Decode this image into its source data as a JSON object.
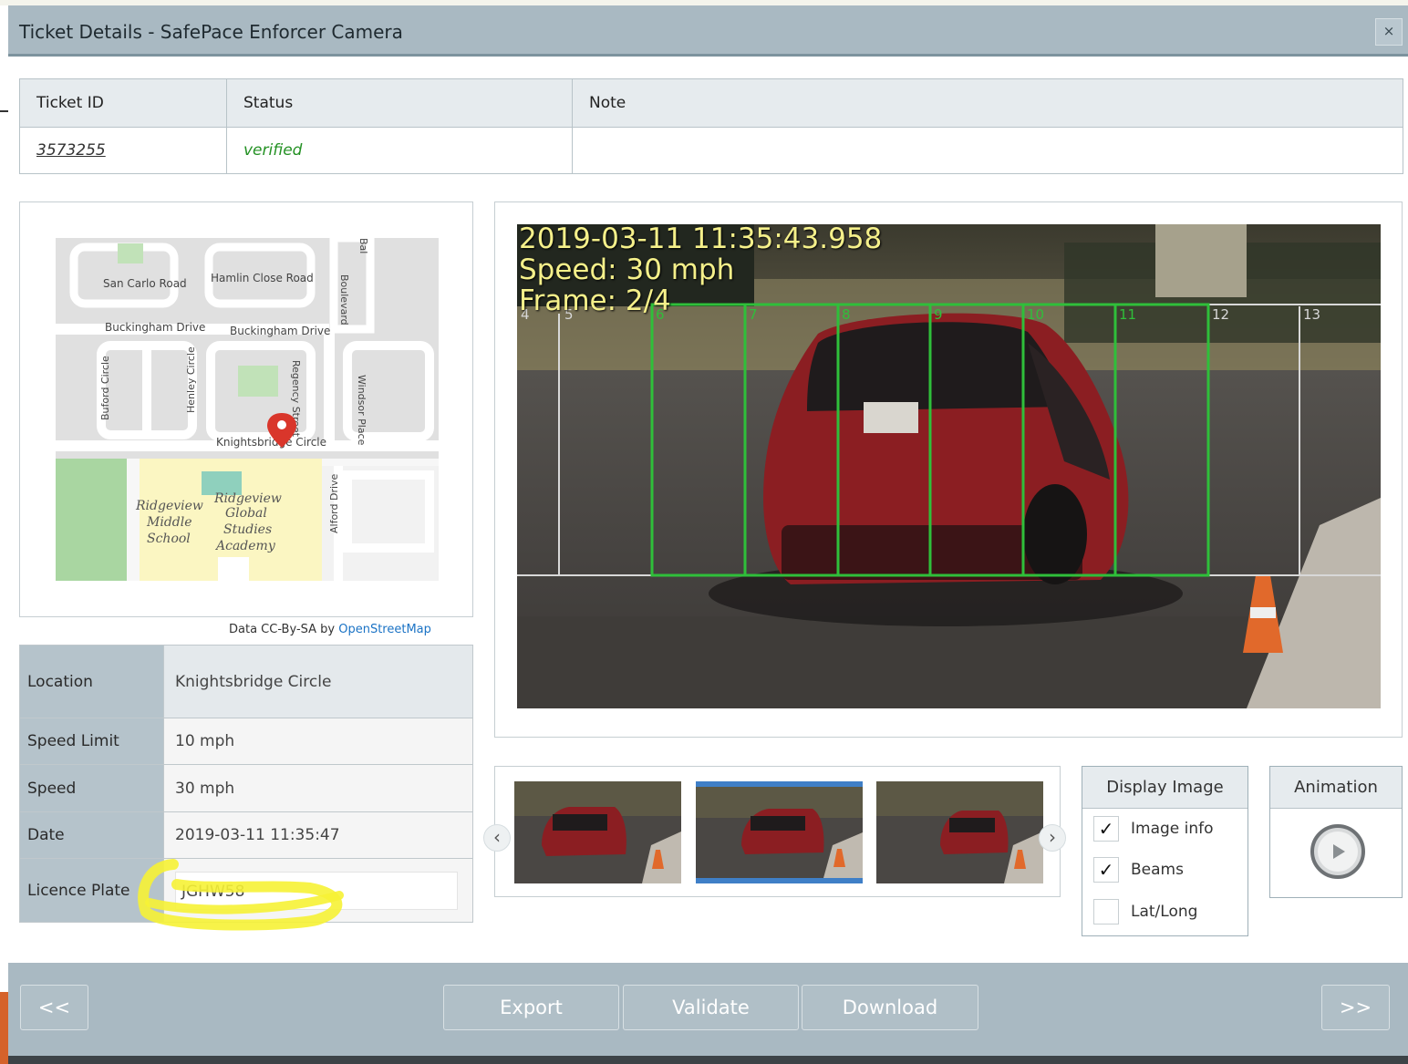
{
  "window": {
    "title": "Ticket Details - SafePace Enforcer Camera",
    "close_label": "×"
  },
  "ticket_table": {
    "headers": [
      "Ticket ID",
      "Status",
      "Note"
    ],
    "row": {
      "ticket_id": "3573255",
      "status": "verified",
      "note": ""
    }
  },
  "map": {
    "labels": {
      "san_carlo": "San Carlo Road",
      "hamlin": "Hamlin Close Road",
      "buckingham_1": "Buckingham Drive",
      "buckingham_2": "Buckingham Drive",
      "buford": "Buford Circle",
      "henley": "Henley Circle",
      "regency": "Regency Street",
      "windsor": "Windsor Place",
      "knightsbridge": "Knightsbridge Circle",
      "school_1_line1": "Ridgeview",
      "school_1_line2": "Middle",
      "school_1_line3": "School",
      "school_2_line1": "Ridgeview",
      "school_2_line2": "Global",
      "school_2_line3": "Studies",
      "school_2_line4": "Academy",
      "alford": "Alford Drive",
      "boulevard": "Boulevard",
      "bal": "Bal"
    },
    "credit_prefix": "Data CC-By-SA by ",
    "credit_link": "OpenStreetMap"
  },
  "info": {
    "location_label": "Location",
    "location_value": "Knightsbridge Circle",
    "speed_limit_label": "Speed Limit",
    "speed_limit_value": "10 mph",
    "speed_label": "Speed",
    "speed_value": "30 mph",
    "date_label": "Date",
    "date_value": "2019-03-11 11:35:47",
    "plate_label": "Licence Plate",
    "plate_value": "JGHW58"
  },
  "photo": {
    "timestamp": "2019-03-11 11:35:43.958",
    "speed": "Speed: 30 mph",
    "frame": "Frame: 2/4",
    "beam_labels": [
      "4",
      "5",
      "6",
      "7",
      "8",
      "9",
      "10",
      "11",
      "12",
      "13"
    ]
  },
  "thumbnails": {
    "prev": "‹",
    "next": "›",
    "selected_index": 1
  },
  "display_image": {
    "title": "Display Image",
    "options": [
      {
        "label": "Image info",
        "checked": "✓"
      },
      {
        "label": "Beams",
        "checked": "✓"
      },
      {
        "label": "Lat/Long",
        "checked": ""
      }
    ]
  },
  "animation": {
    "title": "Animation",
    "icon": "play-icon"
  },
  "footer": {
    "prev": "<<",
    "export": "Export",
    "validate": "Validate",
    "download": "Download",
    "next": ">>"
  },
  "colors": {
    "header_bar": "#a9b9c2",
    "beam_green": "#2fbf3a",
    "beam_white": "#d8d8d8",
    "verified_green": "#239123",
    "highlight_yellow": "#f6f235",
    "selected_blue": "#3f7fc7"
  }
}
